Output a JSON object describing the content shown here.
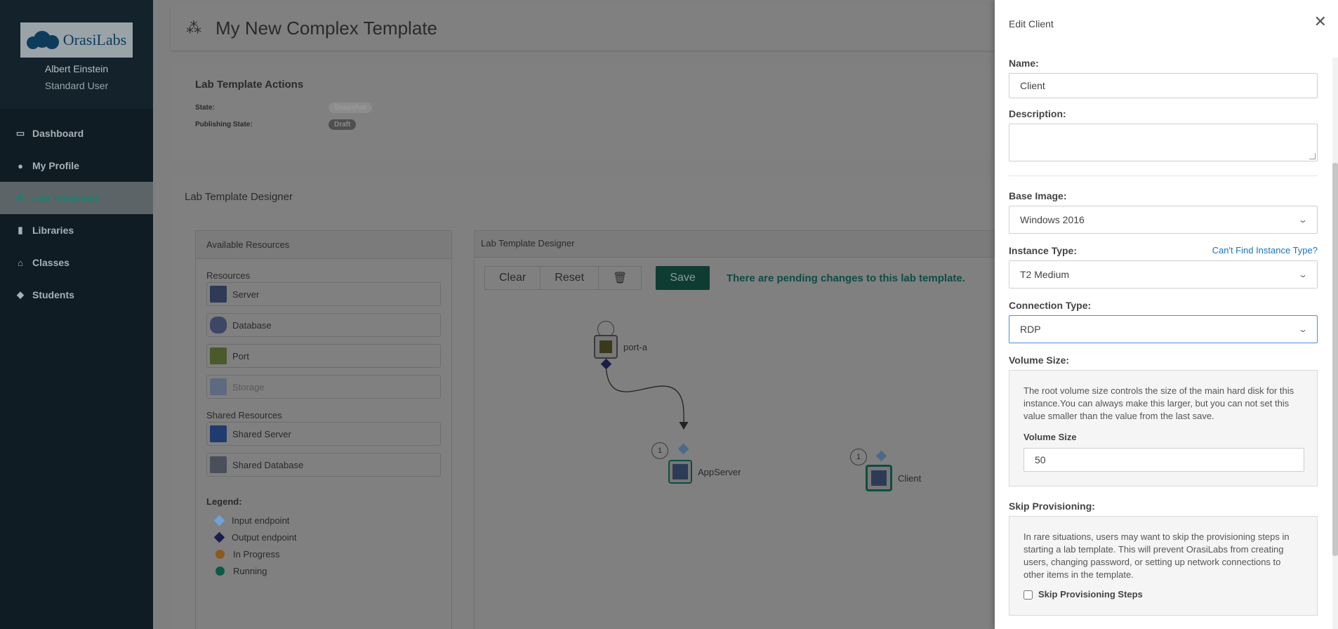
{
  "sidebar": {
    "user_name": "Albert Einstein",
    "user_role": "Standard User",
    "logo_text": "OrasiLabs",
    "items": [
      {
        "label": "Dashboard",
        "icon": "monitor-icon"
      },
      {
        "label": "My Profile",
        "icon": "user-icon"
      },
      {
        "label": "Lab Templates",
        "icon": "cubes-icon",
        "active": true
      },
      {
        "label": "Libraries",
        "icon": "book-icon"
      },
      {
        "label": "Classes",
        "icon": "bank-icon"
      },
      {
        "label": "Students",
        "icon": "graduation-cap-icon"
      }
    ]
  },
  "header": {
    "title": "My New Complex Template"
  },
  "actions": {
    "title": "Lab Template Actions",
    "state_label": "State:",
    "state_value": "Snapshot",
    "publishing_label": "Publishing State:",
    "publishing_value": "Draft"
  },
  "designer": {
    "title": "Lab Template Designer",
    "available_title": "Available Resources",
    "resources_label": "Resources",
    "resources": [
      "Server",
      "Database",
      "Port",
      "Storage"
    ],
    "shared_label": "Shared Resources",
    "shared": [
      "Shared Server",
      "Shared Database"
    ],
    "legend_title": "Legend:",
    "legend": [
      "Input endpoint",
      "Output endpoint",
      "In Progress",
      "Running"
    ],
    "canvas_title": "Lab Template Designer",
    "toolbar": {
      "clear": "Clear",
      "reset": "Reset",
      "save": "Save"
    },
    "pending_message": "There are pending changes to this lab template.",
    "nodes": {
      "port": "port-a",
      "app": "AppServer",
      "client": "Client",
      "app_count": "1",
      "client_count": "1"
    }
  },
  "drawer": {
    "title": "Edit Client",
    "name_label": "Name:",
    "name_value": "Client",
    "description_label": "Description:",
    "description_value": "",
    "base_image_label": "Base Image:",
    "base_image_value": "Windows 2016",
    "instance_label": "Instance Type:",
    "instance_link": "Can't Find Instance Type?",
    "instance_value": "T2 Medium",
    "connection_label": "Connection Type:",
    "connection_value": "RDP",
    "volume_label": "Volume Size:",
    "volume_help": "The root volume size controls the size of the main hard disk for this instance.You can always make this larger, but you can not set this value smaller than the value from the last save.",
    "volume_field_label": "Volume Size",
    "volume_value": "50",
    "skip_label": "Skip Provisioning:",
    "skip_help": "In rare situations, users may want to skip the provisioning steps in starting a lab template. This will prevent OrasiLabs from creating users, changing password, or setting up network connections to other items in the template.",
    "skip_checkbox": "Skip Provisioning Steps"
  },
  "colors": {
    "accent": "#1e7f6d",
    "link": "#1a73b8",
    "input_endpoint": "#6fa3d8",
    "output_endpoint": "#1a1f4a",
    "in_progress": "#c47a1a",
    "running": "#0e8a6a"
  }
}
